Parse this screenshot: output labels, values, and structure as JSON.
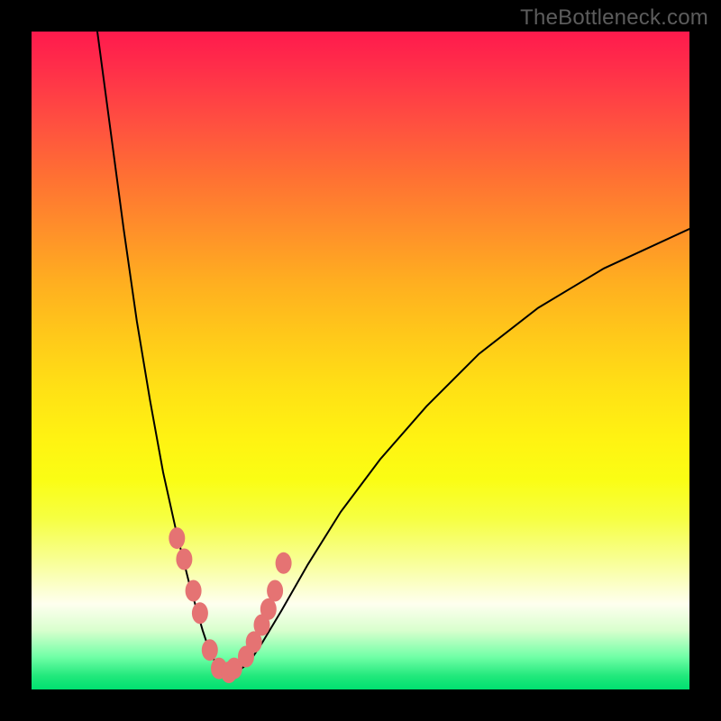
{
  "watermark": "TheBottleneck.com",
  "chart_data": {
    "type": "line",
    "title": "",
    "xlabel": "",
    "ylabel": "",
    "xlim": [
      0,
      100
    ],
    "ylim": [
      0,
      100
    ],
    "grid": false,
    "series": [
      {
        "name": "curve",
        "x": [
          10,
          12,
          14,
          16,
          18,
          20,
          22,
          24,
          26,
          27,
          28,
          29,
          30,
          31,
          33,
          35,
          38,
          42,
          47,
          53,
          60,
          68,
          77,
          87,
          100
        ],
        "y": [
          100,
          85,
          70,
          56,
          44,
          33,
          24,
          16,
          9,
          6,
          4,
          2.5,
          2,
          2.5,
          4,
          7,
          12,
          19,
          27,
          35,
          43,
          51,
          58,
          64,
          70
        ]
      },
      {
        "name": "dots",
        "x": [
          22.1,
          23.2,
          24.6,
          25.6,
          27.1,
          28.5,
          30.0,
          30.8,
          32.6,
          33.8,
          35.0,
          36.0,
          37.0,
          38.3
        ],
        "y": [
          23.0,
          19.8,
          15.0,
          11.6,
          6.0,
          3.2,
          2.6,
          3.2,
          5.0,
          7.2,
          9.8,
          12.2,
          15.0,
          19.2
        ]
      }
    ],
    "colors": {
      "curve": "#000000",
      "dots": "#e57373"
    }
  }
}
